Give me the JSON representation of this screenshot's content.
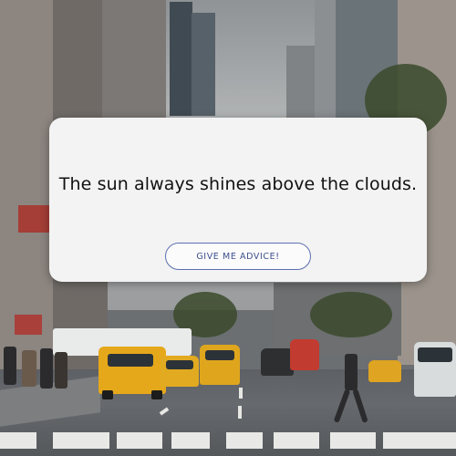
{
  "card": {
    "quote": "The sun always shines above the clouds.",
    "button_label": "GIVE ME ADVICE!"
  },
  "colors": {
    "card_background": "#f3f3f3",
    "button_border": "#5b6fb0",
    "button_text": "#3d4f8e",
    "quote_text": "#111111"
  },
  "background": {
    "scene": "city street with taxis and skyscrapers"
  }
}
